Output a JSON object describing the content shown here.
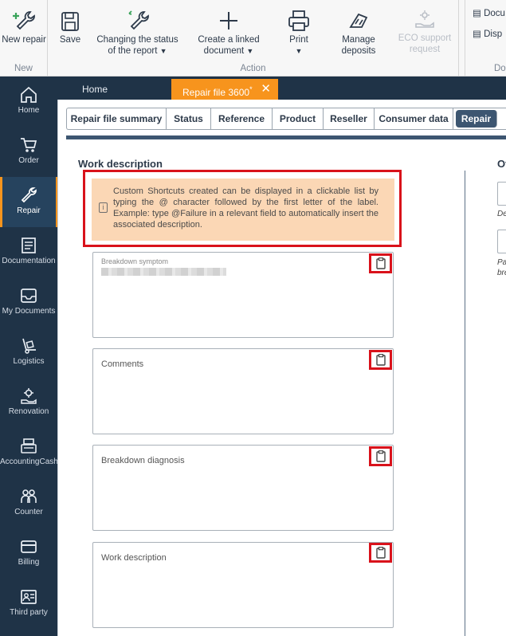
{
  "ribbon": {
    "new": {
      "label": "New repair",
      "group_label": "New"
    },
    "action": {
      "save": "Save",
      "change_status": "Changing the status of the report",
      "create_linked": "Create a linked document",
      "print": "Print",
      "manage_deposits": "Manage deposits",
      "eco_support": "ECO support request",
      "group_label": "Action"
    },
    "docs": {
      "item1": "Docu",
      "item2": "Disp",
      "group_label": "Do"
    }
  },
  "nav": {
    "items": [
      {
        "label": "Home"
      },
      {
        "label": "Order"
      },
      {
        "label": "Repair"
      },
      {
        "label": "Documentation"
      },
      {
        "label": "My Documents"
      },
      {
        "label": "Logistics"
      },
      {
        "label": "Renovation"
      },
      {
        "label": "AccountingCash"
      },
      {
        "label": "Counter"
      },
      {
        "label": "Billing"
      },
      {
        "label": "Third party"
      }
    ],
    "active": "Repair"
  },
  "tabs": {
    "home": "Home",
    "repair_file": "Repair file 3600",
    "repair_file_marker": "*"
  },
  "subtabs": [
    "Repair file summary",
    "Status",
    "Reference",
    "Product",
    "Reseller",
    "Consumer data",
    "Repair"
  ],
  "subtab_active": "Repair",
  "work": {
    "title": "Work description",
    "info": "Custom Shortcuts created can be displayed in a clickable list by typing the @ character followed by the first letter of the label. Example: type @Failure in a relevant field to automatically insert the associated description.",
    "fields": [
      {
        "label": "Breakdown symptom"
      },
      {
        "label": "Comments"
      },
      {
        "label": "Breakdown diagnosis"
      },
      {
        "label": "Work description"
      }
    ]
  },
  "right": {
    "title": "Ot",
    "caption1": "De",
    "caption2a": "Pa",
    "caption2b": "bre"
  },
  "colors": {
    "accent": "#f7941d",
    "nav_bg": "#1f3347",
    "highlight": "#d9121b",
    "info_bg": "#fbd7b5"
  }
}
